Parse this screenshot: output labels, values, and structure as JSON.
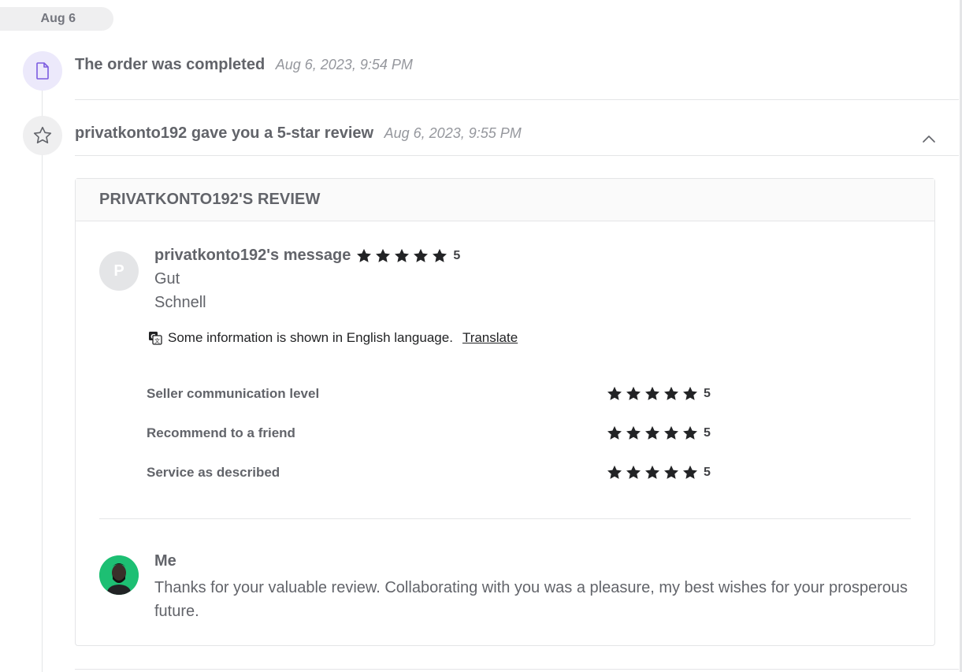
{
  "timeline": {
    "date_label": "Aug 6",
    "events": [
      {
        "title": "The order was completed",
        "timestamp": "Aug 6, 2023, 9:54 PM",
        "icon": "document-icon"
      },
      {
        "title": "privatkonto192 gave you a 5-star review",
        "timestamp": "Aug 6, 2023, 9:55 PM",
        "icon": "star-outline-icon"
      }
    ]
  },
  "review": {
    "header": "PRIVATKONTO192'S REVIEW",
    "buyer": {
      "avatar_letter": "P",
      "message_title": "privatkonto192's message",
      "rating": "5",
      "lines": [
        "Gut",
        "Schnell"
      ]
    },
    "translation": {
      "notice": "Some information is shown in English language.",
      "link": "Translate"
    },
    "ratings": [
      {
        "label": "Seller communication level",
        "value": "5"
      },
      {
        "label": "Recommend to a friend",
        "value": "5"
      },
      {
        "label": "Service as described",
        "value": "5"
      }
    ],
    "reply": {
      "name": "Me",
      "text": "Thanks for your valuable review. Collaborating with you was a pleasure, my best wishes for your prosperous future."
    }
  },
  "colors": {
    "accent_purple": "#ece9fb",
    "star": "#222325",
    "avatar_green": "#1dbf73"
  }
}
